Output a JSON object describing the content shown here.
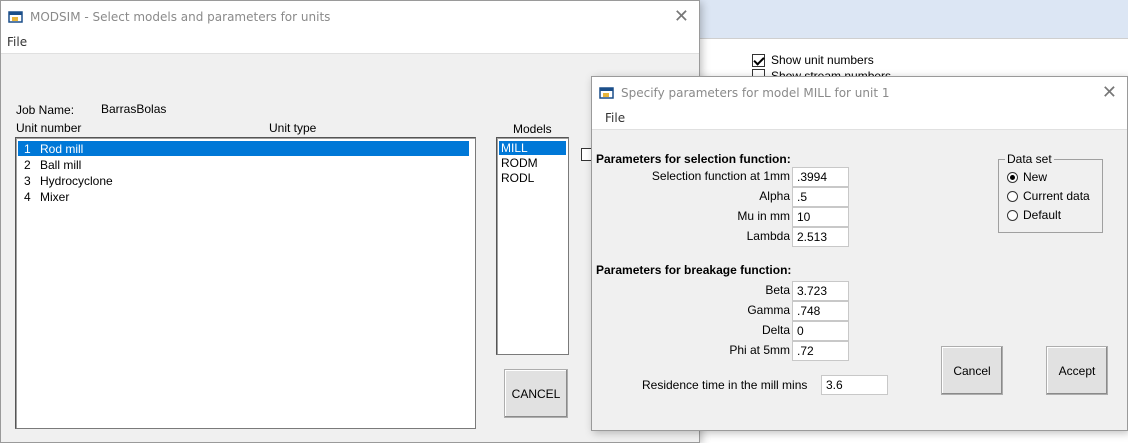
{
  "background": {
    "check_show_unit_numbers": "Show unit numbers",
    "check_show_stream_numbers": "Show stream numbers"
  },
  "main_window": {
    "title": "MODSIM - Select models and parameters for units",
    "menu_file": "File",
    "job_name_label": "Job Name:",
    "job_name_value": "BarrasBolas",
    "col_unit_number": "Unit number",
    "col_unit_type": "Unit type",
    "col_models": "Models",
    "units": [
      {
        "num": "1",
        "name": "Rod mill",
        "selected": true
      },
      {
        "num": "2",
        "name": "Ball mill",
        "selected": false
      },
      {
        "num": "3",
        "name": "Hydrocyclone",
        "selected": false
      },
      {
        "num": "4",
        "name": "Mixer",
        "selected": false
      }
    ],
    "models": [
      {
        "name": "MILL",
        "selected": true
      },
      {
        "name": "RODM",
        "selected": false
      },
      {
        "name": "RODL",
        "selected": false
      }
    ],
    "cancel_label": "CANCEL"
  },
  "dialog": {
    "title": "Specify parameters for model MILL for unit 1",
    "menu_file": "File",
    "selection_section": "Parameters for selection function:",
    "selection_params": [
      {
        "label": "Selection function at 1mm",
        "value": ".3994"
      },
      {
        "label": "Alpha",
        "value": ".5"
      },
      {
        "label": "Mu in mm",
        "value": "10"
      },
      {
        "label": "Lambda",
        "value": "2.513"
      }
    ],
    "breakage_section": "Parameters for breakage function:",
    "breakage_params": [
      {
        "label": "Beta",
        "value": "3.723"
      },
      {
        "label": "Gamma",
        "value": ".748"
      },
      {
        "label": "Delta",
        "value": "0"
      },
      {
        "label": "Phi at 5mm",
        "value": ".72"
      }
    ],
    "residence_label": "Residence time in the mill  mins",
    "residence_value": "3.6",
    "dataset_title": "Data set",
    "dataset_options": [
      {
        "label": "New",
        "checked": true
      },
      {
        "label": "Current data",
        "checked": false
      },
      {
        "label": "Default",
        "checked": false
      }
    ],
    "cancel_label": "Cancel",
    "accept_label": "Accept"
  },
  "colors": {
    "selection": "#0078d7",
    "window_bg": "#f0f0f0",
    "titlebar_bg": "#ffffff"
  }
}
